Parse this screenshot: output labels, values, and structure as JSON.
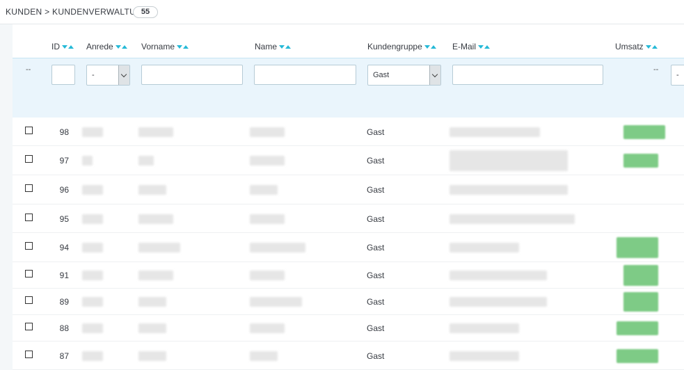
{
  "breadcrumb": {
    "text": "Kunden > Kundenverwaltung",
    "count": "55"
  },
  "columns": {
    "id": "ID",
    "anrede": "Anrede",
    "vorname": "Vorname",
    "name": "Name",
    "kundengruppe": "Kundengruppe",
    "email": "E-Mail",
    "umsatz": "Umsatz"
  },
  "filters": {
    "bulk": "--",
    "anrede": "-",
    "kundengruppe": "Gast",
    "umsatz": "--",
    "next": "-"
  },
  "rows": [
    {
      "id": "98",
      "group": "Gast"
    },
    {
      "id": "97",
      "group": "Gast"
    },
    {
      "id": "96",
      "group": "Gast"
    },
    {
      "id": "95",
      "group": "Gast"
    },
    {
      "id": "94",
      "group": "Gast"
    },
    {
      "id": "91",
      "group": "Gast"
    },
    {
      "id": "89",
      "group": "Gast"
    },
    {
      "id": "88",
      "group": "Gast"
    },
    {
      "id": "87",
      "group": "Gast"
    }
  ],
  "colors": {
    "accent": "#25b9d7",
    "filter_bg": "#eaf5fc",
    "sales": "#7ecb86"
  }
}
